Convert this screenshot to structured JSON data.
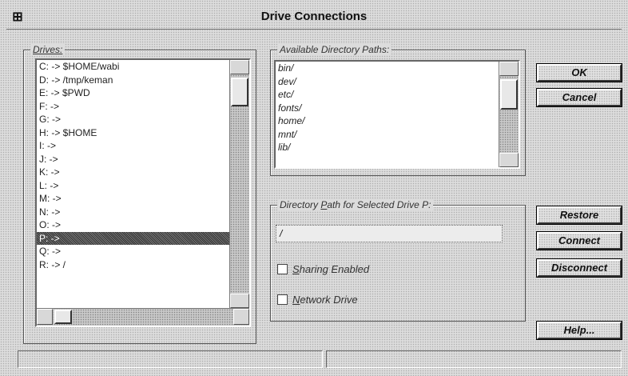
{
  "window": {
    "title": "Drive Connections",
    "system_menu_glyph": "⊞"
  },
  "drives": {
    "label": "Drives:",
    "items": [
      "C: -> $HOME/wabi",
      "D: -> /tmp/keman",
      "E: -> $PWD",
      "F: ->",
      "G: ->",
      "H: -> $HOME",
      "I: ->",
      "J: ->",
      "K: ->",
      "L: ->",
      "M: ->",
      "N: ->",
      "O: ->",
      "P: ->",
      "Q: ->",
      "R: -> /"
    ],
    "selected_index": 13
  },
  "paths": {
    "label": "Available Directory Paths:",
    "items": [
      "bin/",
      "dev/",
      "etc/",
      "fonts/",
      "home/",
      "mnt/",
      "lib/"
    ]
  },
  "selected_drive": {
    "label_prefix": "Directory ",
    "label_underlined": "P",
    "label_suffix": "ath for Selected Drive P:",
    "path_value": "/"
  },
  "options": {
    "sharing_underlined": "S",
    "sharing_rest": "haring Enabled",
    "network_underlined": "N",
    "network_rest": "etwork Drive"
  },
  "buttons": {
    "ok": "OK",
    "cancel": "Cancel",
    "restore": "Restore",
    "connect": "Connect",
    "disconnect": "Disconnect",
    "help": "Help..."
  },
  "status_bar": {
    "left": "",
    "right": ""
  }
}
